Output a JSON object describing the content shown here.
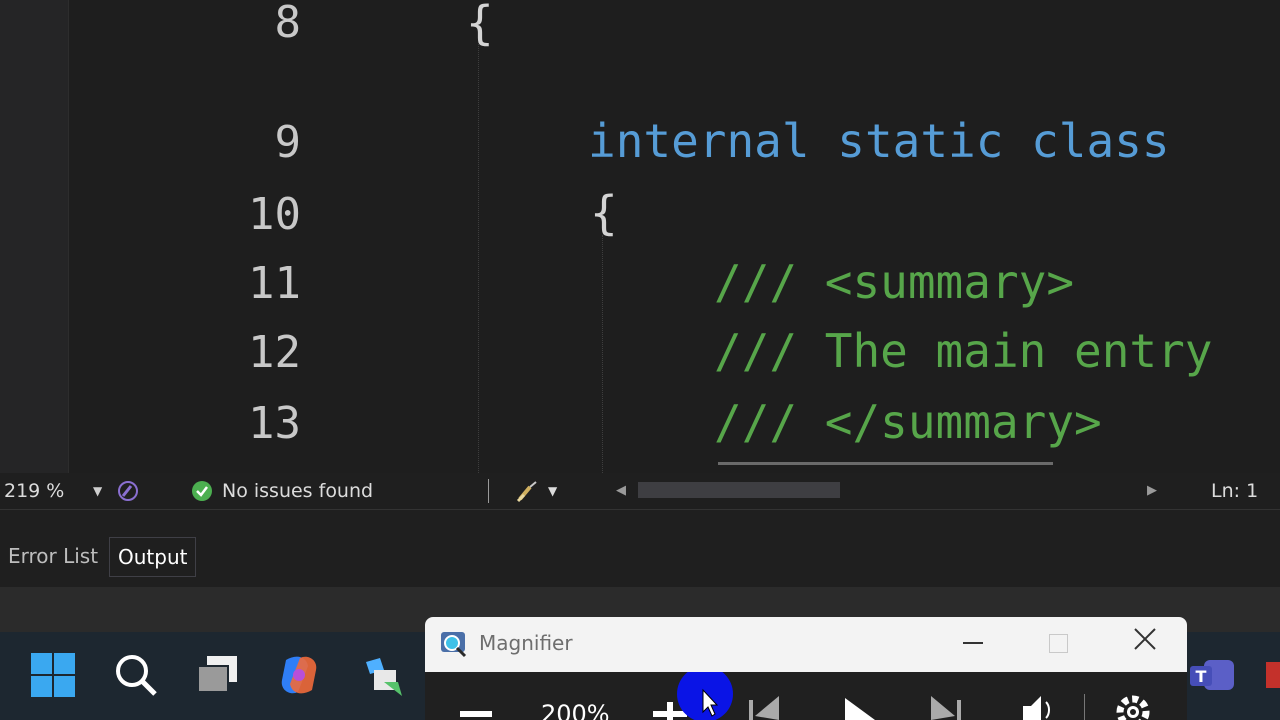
{
  "editor": {
    "lines": [
      {
        "num": "8",
        "text": "{"
      },
      {
        "num": "9",
        "text": "internal static class"
      },
      {
        "num": "10",
        "text": "{"
      },
      {
        "num": "11",
        "text": "/// <summary>"
      },
      {
        "num": "12",
        "text": "/// The main entry"
      },
      {
        "num": "13",
        "text": "/// </summary>"
      }
    ]
  },
  "statusbar": {
    "zoom": "219 %",
    "issues": "No issues found",
    "position": "Ln: 1"
  },
  "panel": {
    "tabs": [
      {
        "label": "Error List"
      },
      {
        "label": "Output"
      }
    ]
  },
  "magnifier": {
    "title": "Magnifier",
    "zoom": "200%"
  },
  "colors": {
    "keyword": "#569cd6",
    "comment": "#57a64a",
    "issues_ok": "#4caf50",
    "teams": "#5b5fc7"
  },
  "icons": [
    "windows-start-icon",
    "search-icon",
    "task-view-icon",
    "copilot-icon",
    "store-icon",
    "teams-icon",
    "magnifier-app-icon",
    "check-circle-icon",
    "brush-icon"
  ]
}
